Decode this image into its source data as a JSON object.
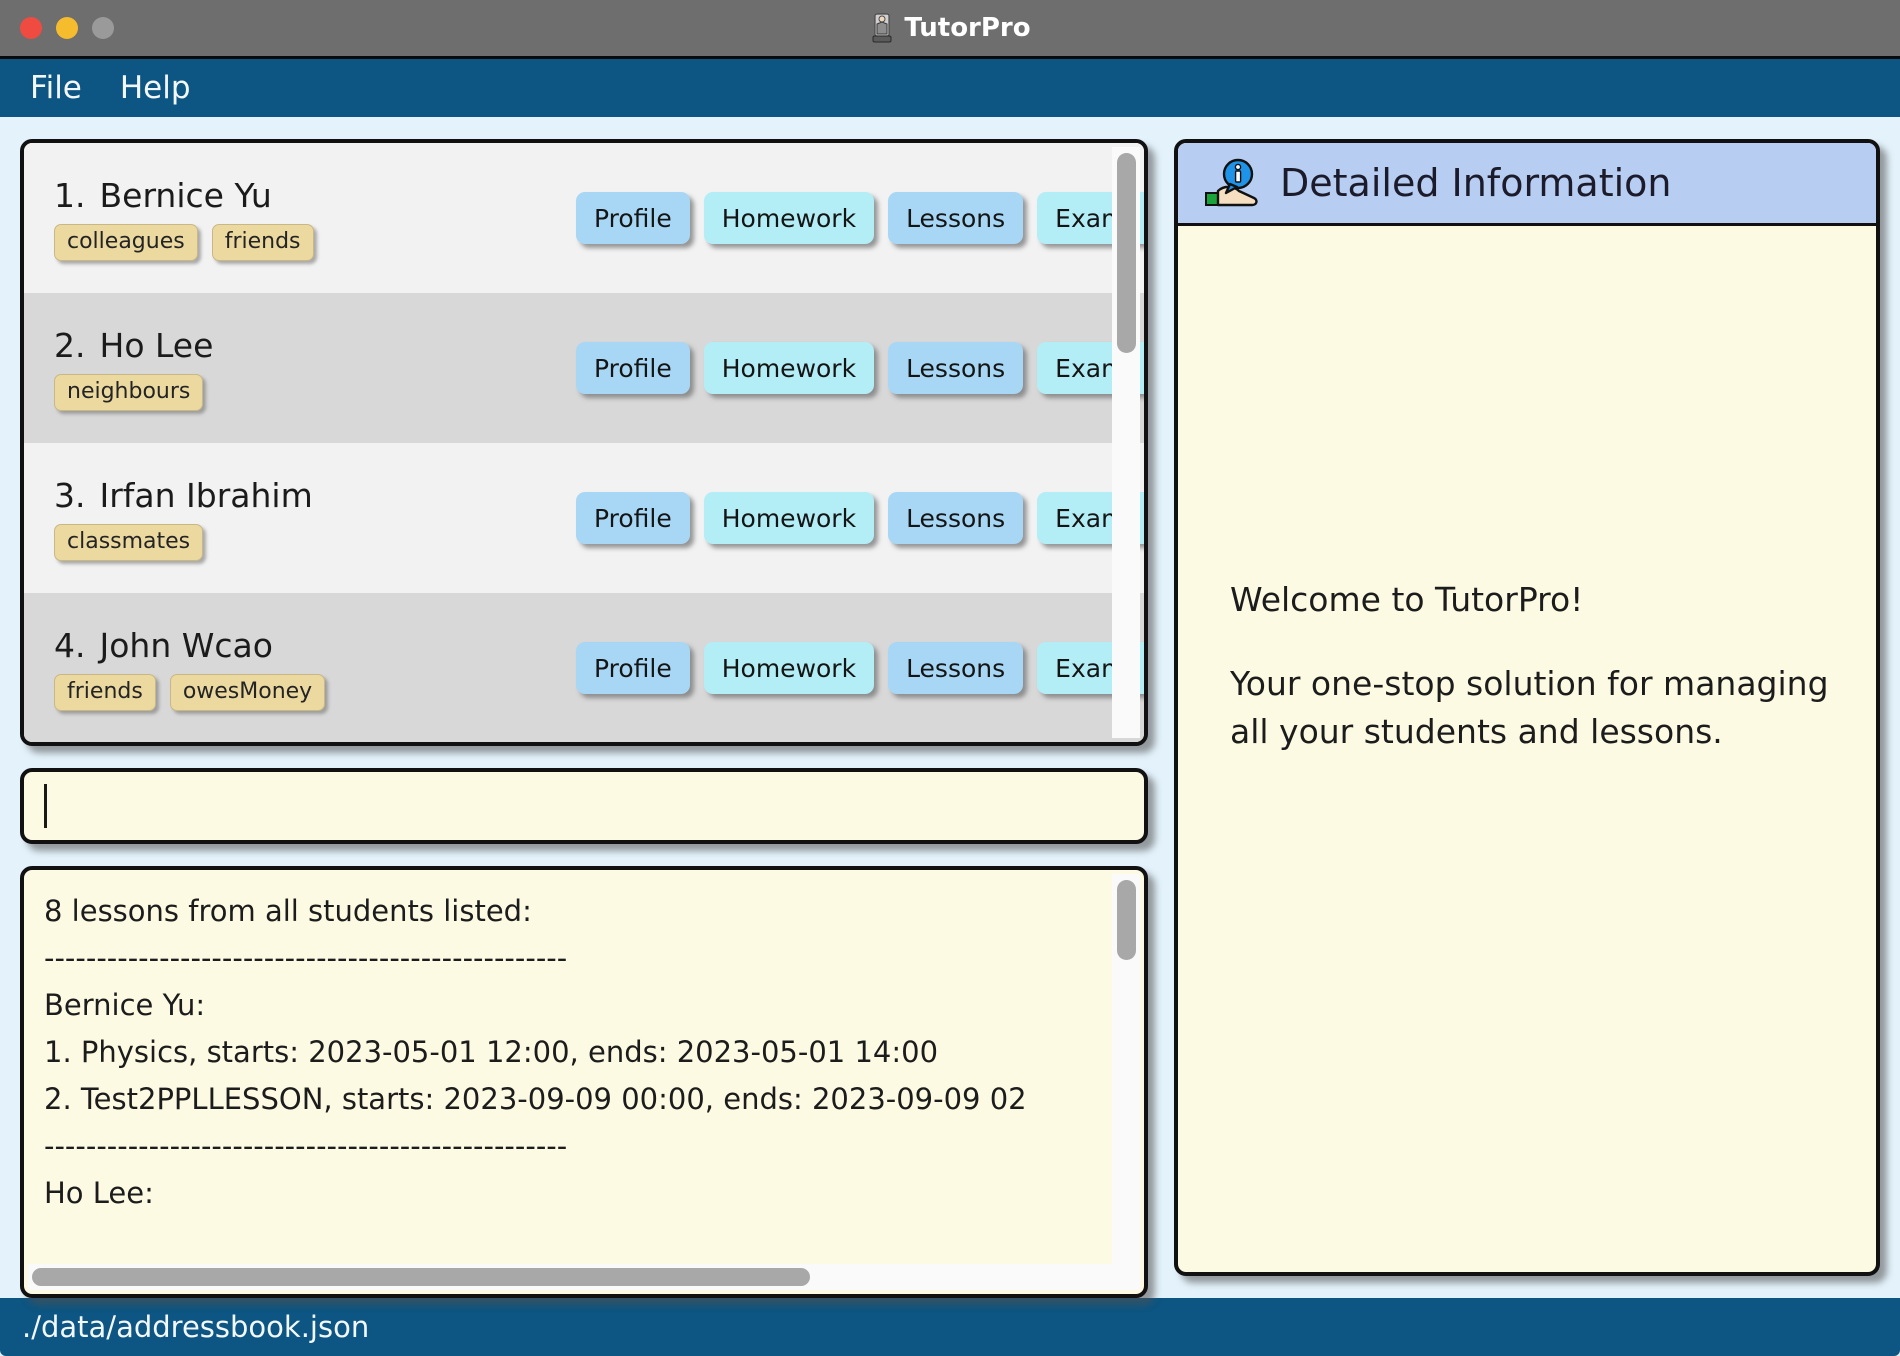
{
  "window": {
    "title": "TutorPro",
    "icon": "tutor-person-icon",
    "traffic_lights": [
      "close",
      "minimize",
      "zoom"
    ]
  },
  "menubar": {
    "items": [
      {
        "label": "File"
      },
      {
        "label": "Help"
      }
    ]
  },
  "student_list": {
    "row_buttons": [
      "Profile",
      "Homework",
      "Lessons",
      "Exams"
    ],
    "students": [
      {
        "index": "1.",
        "name": "Bernice Yu",
        "tags": [
          "colleagues",
          "friends"
        ]
      },
      {
        "index": "2.",
        "name": "Ho Lee",
        "tags": [
          "neighbours"
        ]
      },
      {
        "index": "3.",
        "name": "Irfan Ibrahim",
        "tags": [
          "classmates"
        ]
      },
      {
        "index": "4.",
        "name": "John Wcao",
        "tags": [
          "friends",
          "owesMoney"
        ]
      }
    ]
  },
  "command_input": {
    "value": "",
    "placeholder": ""
  },
  "result_display": {
    "lines": [
      "8 lessons from all students listed:",
      "--------------------------------------------------",
      "Bernice Yu:",
      "1. Physics, starts: 2023-05-01 12:00, ends: 2023-05-01 14:00",
      "2. Test2PPLLESSON, starts: 2023-09-09 00:00, ends: 2023-09-09 02",
      "--------------------------------------------------",
      "Ho Lee:"
    ]
  },
  "detail_panel": {
    "icon": "info-on-hand-icon",
    "title": "Detailed Information",
    "welcome_heading": "Welcome to TutorPro!",
    "welcome_body_line1": "Your one-stop solution for managing",
    "welcome_body_line2": "all your students and lessons."
  },
  "statusbar": {
    "file_path": "./data/addressbook.json"
  },
  "colors": {
    "menubar": "#0d5582",
    "titlebar": "#6e6e6e",
    "app_background": "#e3f2fb",
    "button_blue": "#a7d7f5",
    "button_cyan": "#b3eef7",
    "tag_yellow": "#ecd9a0",
    "panel_cream": "#fdfae3",
    "detail_header": "#b7cdf2",
    "row_odd": "#f2f2f2",
    "row_even": "#d8d8d8"
  }
}
